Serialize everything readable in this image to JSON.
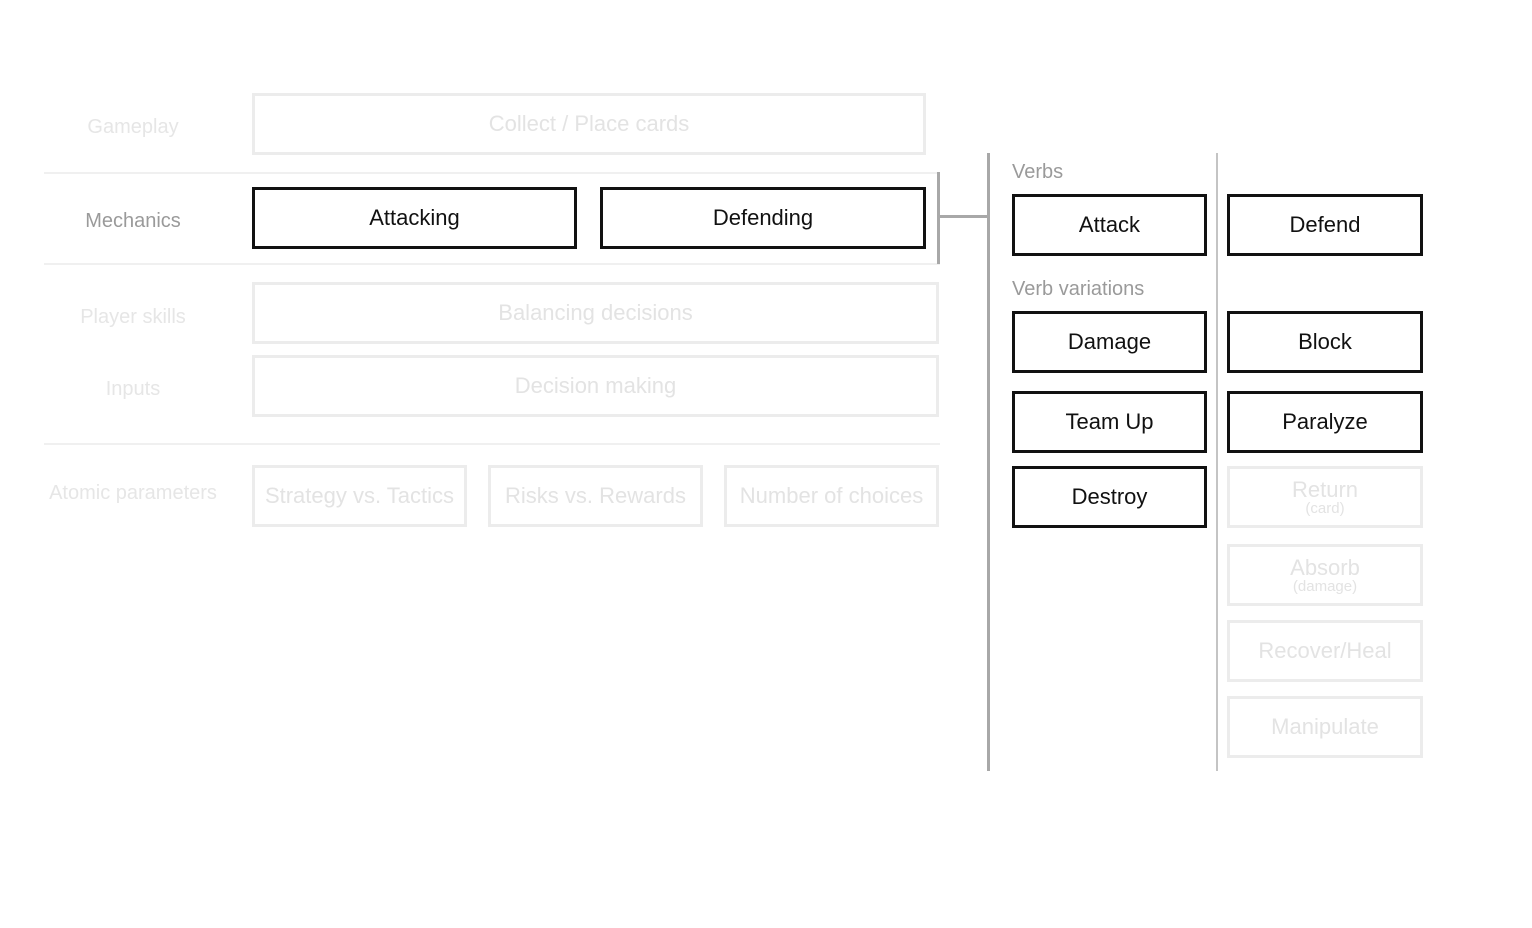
{
  "left_panel": {
    "rows": [
      {
        "label": "Gameplay",
        "active": false
      },
      {
        "label": "Mechanics",
        "active": true
      },
      {
        "label": "Player skills",
        "active": false
      },
      {
        "label": "Inputs",
        "active": false
      },
      {
        "label": "Atomic parameters",
        "active": false
      }
    ],
    "gameplay": [
      "Collect / Place cards"
    ],
    "mechanics": [
      "Attacking",
      "Defending"
    ],
    "player_skills": [
      "Balancing decisions"
    ],
    "inputs": [
      "Decision making"
    ],
    "atomic_parameters": [
      "Strategy vs. Tactics",
      "Risks vs. Rewards",
      "Number of choices"
    ]
  },
  "right_panel": {
    "verbs_label": "Verbs",
    "verbs": [
      "Attack",
      "Defend"
    ],
    "variations_label": "Verb variations",
    "attack_variations": [
      {
        "label": "Damage",
        "active": true
      },
      {
        "label": "Team Up",
        "active": true
      },
      {
        "label": "Destroy",
        "active": true
      }
    ],
    "defend_variations": [
      {
        "label": "Block",
        "active": true
      },
      {
        "label": "Paralyze",
        "active": true
      },
      {
        "label": "Return",
        "sub": "(card)",
        "active": false
      },
      {
        "label": "Absorb",
        "sub": "(damage)",
        "active": false
      },
      {
        "label": "Recover/Heal",
        "active": false
      },
      {
        "label": "Manipulate",
        "active": false
      }
    ]
  }
}
